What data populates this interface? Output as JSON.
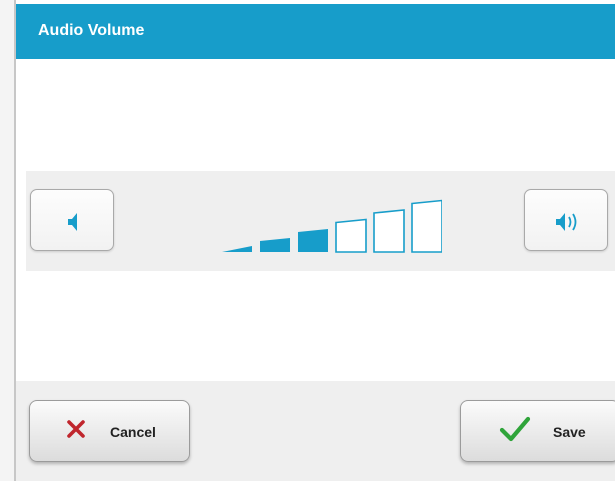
{
  "dialog": {
    "title": "Audio Volume"
  },
  "volume": {
    "level": 3,
    "max": 6,
    "decrease_icon": "speaker-low-icon",
    "increase_icon": "speaker-high-icon",
    "accent_color": "#179dca"
  },
  "footer": {
    "cancel_label": "Cancel",
    "cancel_icon": "x-icon",
    "cancel_icon_color": "#c0262d",
    "save_label": "Save",
    "save_icon": "checkmark-icon",
    "save_icon_color": "#2fa43a"
  }
}
